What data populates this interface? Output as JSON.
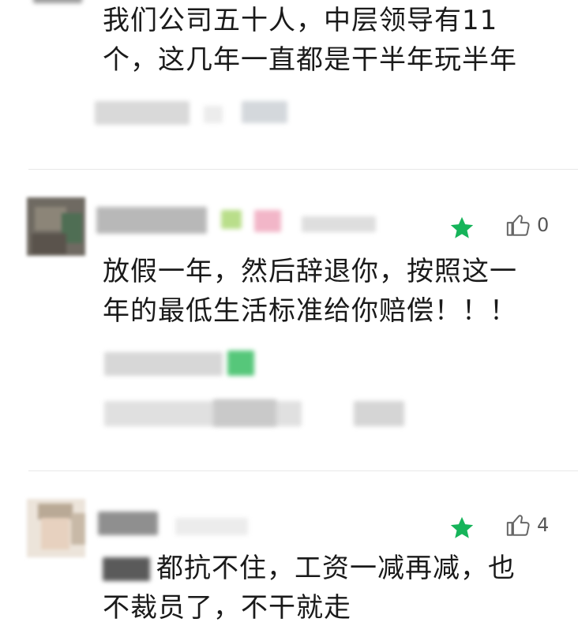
{
  "comments": [
    {
      "text_lines": [
        "我们公司五十人，中层领导有11",
        "个，这几年一直都是干半年玩半年"
      ]
    },
    {
      "like_count": "0",
      "text_lines": [
        "放假一年，然后辞退你，按照这一",
        "年的最低生活标准给你赔偿！！！"
      ]
    },
    {
      "like_count": "4",
      "text_lines": [
        "都抗不住，工资一减再减，也",
        "不裁员了，不干就走"
      ]
    }
  ],
  "colors": {
    "star": "#16b45a",
    "text": "#1a1a1a",
    "like_icon": "#666666"
  },
  "icons": {
    "star": "star-icon",
    "like": "thumbs-up-icon"
  }
}
